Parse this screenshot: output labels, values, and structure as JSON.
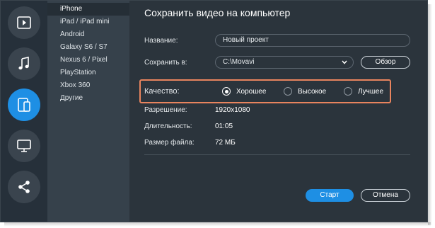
{
  "sidebar_rail": {
    "items": [
      {
        "name": "video",
        "icon": "video-icon",
        "active": false
      },
      {
        "name": "audio",
        "icon": "music-note-icon",
        "active": false
      },
      {
        "name": "devices",
        "icon": "devices-icon",
        "active": true
      },
      {
        "name": "tv",
        "icon": "monitor-icon",
        "active": false
      },
      {
        "name": "share",
        "icon": "share-icon",
        "active": false
      }
    ]
  },
  "devices": {
    "items": [
      "iPhone",
      "iPad / iPad mini",
      "Android",
      "Galaxy S6 / S7",
      "Nexus 6 / Pixel",
      "PlayStation",
      "Xbox 360",
      "Другие"
    ],
    "selected": "iPhone"
  },
  "main": {
    "title": "Сохранить видео на компьютер",
    "name_label": "Название:",
    "name_value": "Новый проект",
    "save_label": "Сохранить в:",
    "save_path": "C:\\Movavi",
    "browse_button": "Обзор",
    "quality_label": "Качество:",
    "quality_options": [
      {
        "label": "Хорошее",
        "selected": true
      },
      {
        "label": "Высокое",
        "selected": false
      },
      {
        "label": "Лучшее",
        "selected": false
      }
    ],
    "resolution_label": "Разрешение:",
    "resolution_value": "1920x1080",
    "duration_label": "Длительность:",
    "duration_value": "01:05",
    "filesize_label": "Размер файла:",
    "filesize_value": "72 МБ",
    "start_button": "Старт",
    "cancel_button": "Отмена"
  },
  "colors": {
    "accent": "#1e8fe4",
    "background": "#2b343c",
    "highlight": "#e8845e"
  }
}
